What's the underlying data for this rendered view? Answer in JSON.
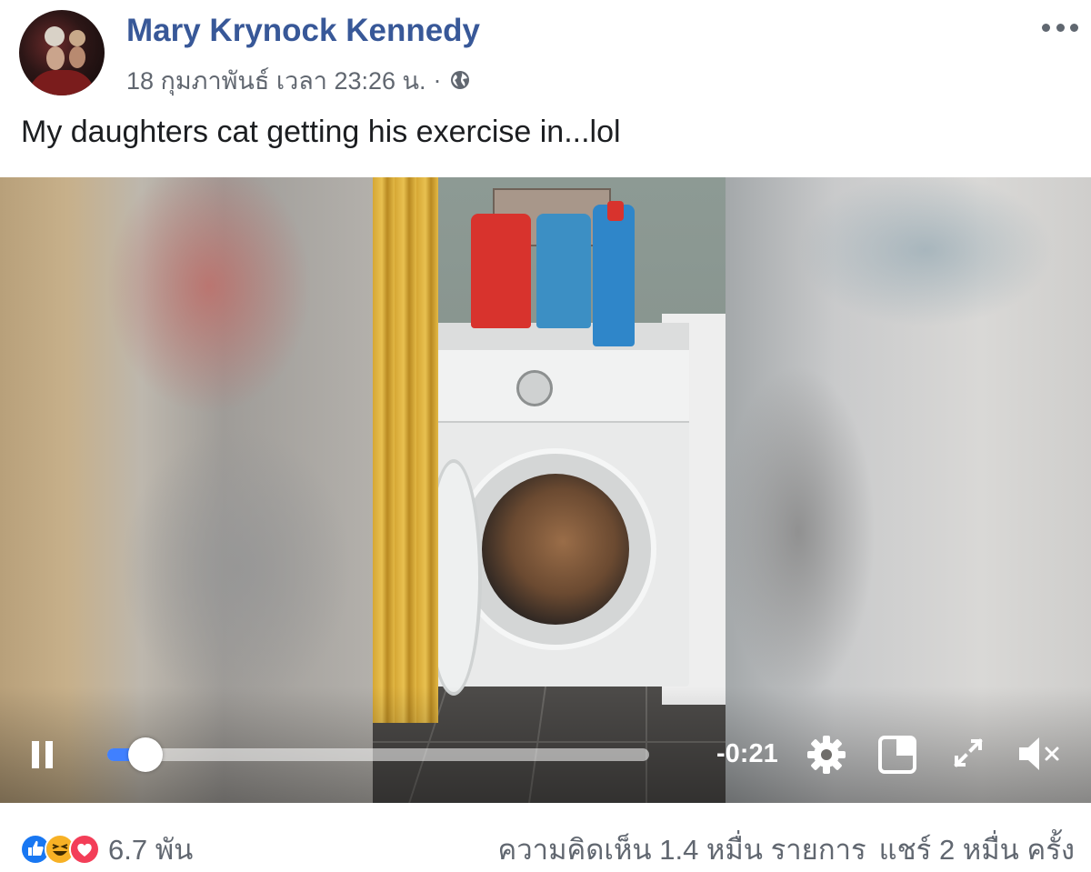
{
  "post": {
    "author": "Mary Krynock Kennedy",
    "timestamp": "18 กุมภาพันธ์ เวลา 23:26 น.",
    "separator": "·",
    "audience_icon": "globe-icon",
    "more_icon": "more-options-icon",
    "caption": "My daughters cat getting his exercise in...lol"
  },
  "video": {
    "state": "playing",
    "time_remaining": "-0:21",
    "progress": 0.07,
    "controls": [
      "pause-icon",
      "gear-icon",
      "pip-icon",
      "fullscreen-icon",
      "volume-muted-icon"
    ]
  },
  "engagement": {
    "reactions": [
      "like",
      "haha",
      "love"
    ],
    "reaction_count": "6.7 พัน",
    "comments": "ความคิดเห็น 1.4 หมื่น รายการ",
    "shares": "แชร์ 2 หมื่น ครั้ง"
  },
  "colors": {
    "author_link": "#385898",
    "meta_text": "#616770",
    "like_blue": "#1877f2",
    "love_red": "#f33e58",
    "haha_yellow": "#f7b125",
    "progress_blue": "#4080ff"
  }
}
